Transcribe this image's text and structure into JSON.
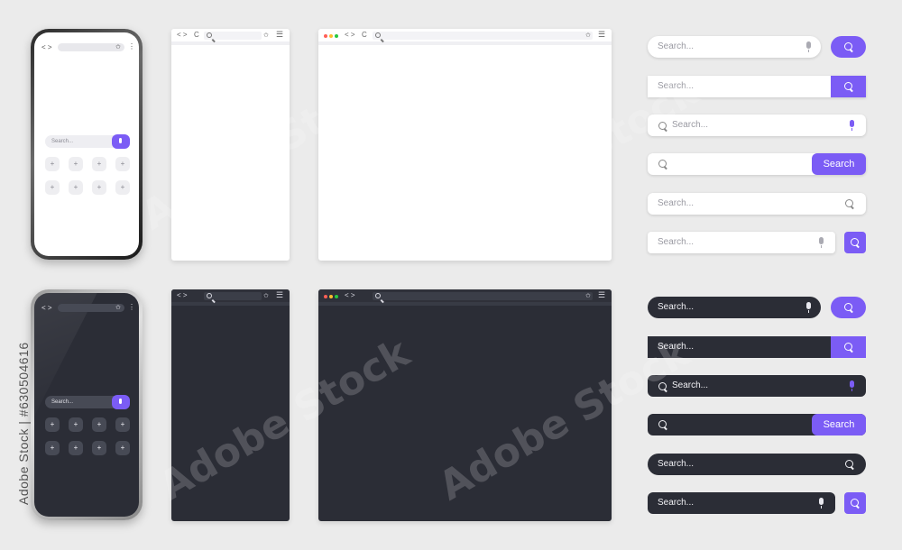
{
  "colors": {
    "background": "#ebebeb",
    "accent": "#7b5cf5",
    "dark_surface": "#2b2d36",
    "light_surface": "#ffffff"
  },
  "nav_symbol": "< >",
  "reload_symbol": "C",
  "star_symbol": "✩",
  "menu_symbol": "☰",
  "more_symbol": "⋮",
  "plus_symbol": "+",
  "phone_search_placeholder": "Search...",
  "search_placeholder": "Search...",
  "search_button_label": "Search",
  "stock_id": "Adobe Stock | #630504616",
  "watermark_text": "Adobe Stock",
  "icons": [
    "search-icon",
    "mic-icon",
    "star-icon",
    "menu-icon",
    "back-forward-icon",
    "reload-icon",
    "plus-icon"
  ]
}
